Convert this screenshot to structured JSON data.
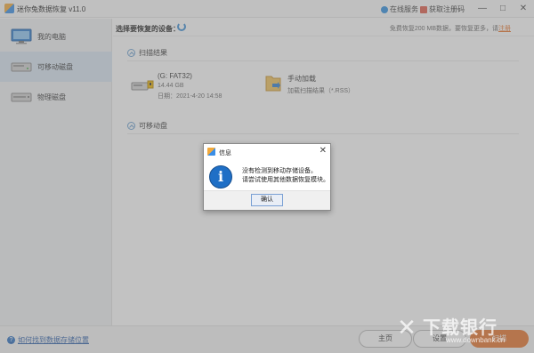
{
  "app": {
    "title": "迷你兔数据恢复 v11.0",
    "online_service": "在线服务",
    "get_reg_code": "获取注册码",
    "minimize": "—",
    "maximize": "□",
    "close": "✕"
  },
  "sidebar": {
    "items": [
      {
        "label": "我的电脑",
        "icon": "monitor-icon"
      },
      {
        "label": "可移动磁盘",
        "icon": "removable-drive-icon"
      },
      {
        "label": "物理磁盘",
        "icon": "physical-disk-icon"
      }
    ],
    "active_index": 1
  },
  "topbar": {
    "title": "选择要恢复的设备：",
    "note": "免费恢复200 MB数据，要恢复更多，请",
    "reg_link": "注册"
  },
  "scan_results": {
    "heading": "扫描结果",
    "drive": {
      "label": "(G: FAT32)",
      "size": "14.44 GB",
      "date": "日期：2021-4-20 14:58"
    },
    "manual": {
      "label": "手动加载",
      "sub": "加载扫描结果（*.RSS）"
    }
  },
  "removable": {
    "heading": "可移动盘"
  },
  "footer": {
    "help_link": "如何找到数据存储位置",
    "home": "主页",
    "settings": "设置",
    "scan": "扫描"
  },
  "dialog": {
    "title": "信息",
    "close": "✕",
    "message_line1": "没有检测到移动存储设备。",
    "message_line2": "请尝试使用其他数据恢复模块。",
    "ok": "确认"
  },
  "watermark": {
    "text": "下载银行",
    "url": "www.downbank.cn"
  },
  "colors": {
    "accent": "#e8742a",
    "link": "#2a5da8",
    "sidebar_active": "#d9e6f2",
    "info_blue": "#1f6fc6"
  }
}
